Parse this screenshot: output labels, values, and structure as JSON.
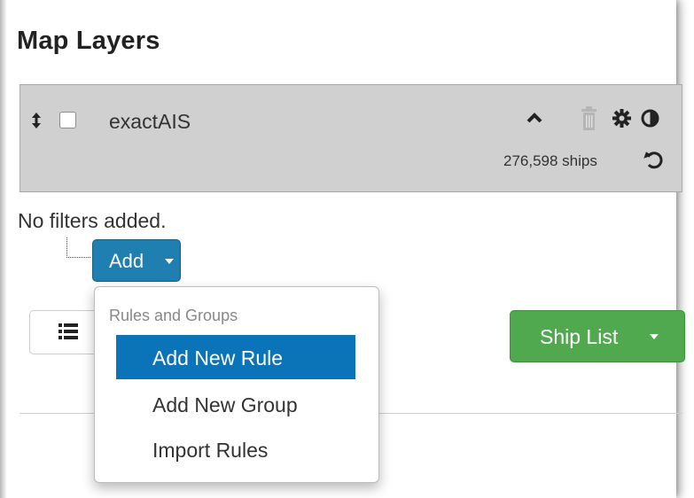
{
  "panel": {
    "title": "Map Layers"
  },
  "layer": {
    "name": "exactAIS",
    "checked": false,
    "ship_count": "276,598 ships",
    "icons": [
      "sort-icon",
      "chevron-up-icon",
      "trash-icon",
      "gear-icon",
      "contrast-icon",
      "refresh-icon"
    ]
  },
  "filters": {
    "empty_text": "No filters added.",
    "add_button_label": "Add"
  },
  "dropdown": {
    "header": "Rules and Groups",
    "items": [
      {
        "label": "Add New Rule",
        "active": true
      },
      {
        "label": "Add New Group",
        "active": false
      },
      {
        "label": "Import Rules",
        "active": false
      }
    ]
  },
  "toolbar": {
    "list_icon": "list-icon",
    "ship_list_label": "Ship List"
  },
  "colors": {
    "add_button": "#1f7fb0",
    "active_menu_item": "#0b74b8",
    "ship_list_button": "#51a94f",
    "layer_panel": "#d0d0d0"
  }
}
